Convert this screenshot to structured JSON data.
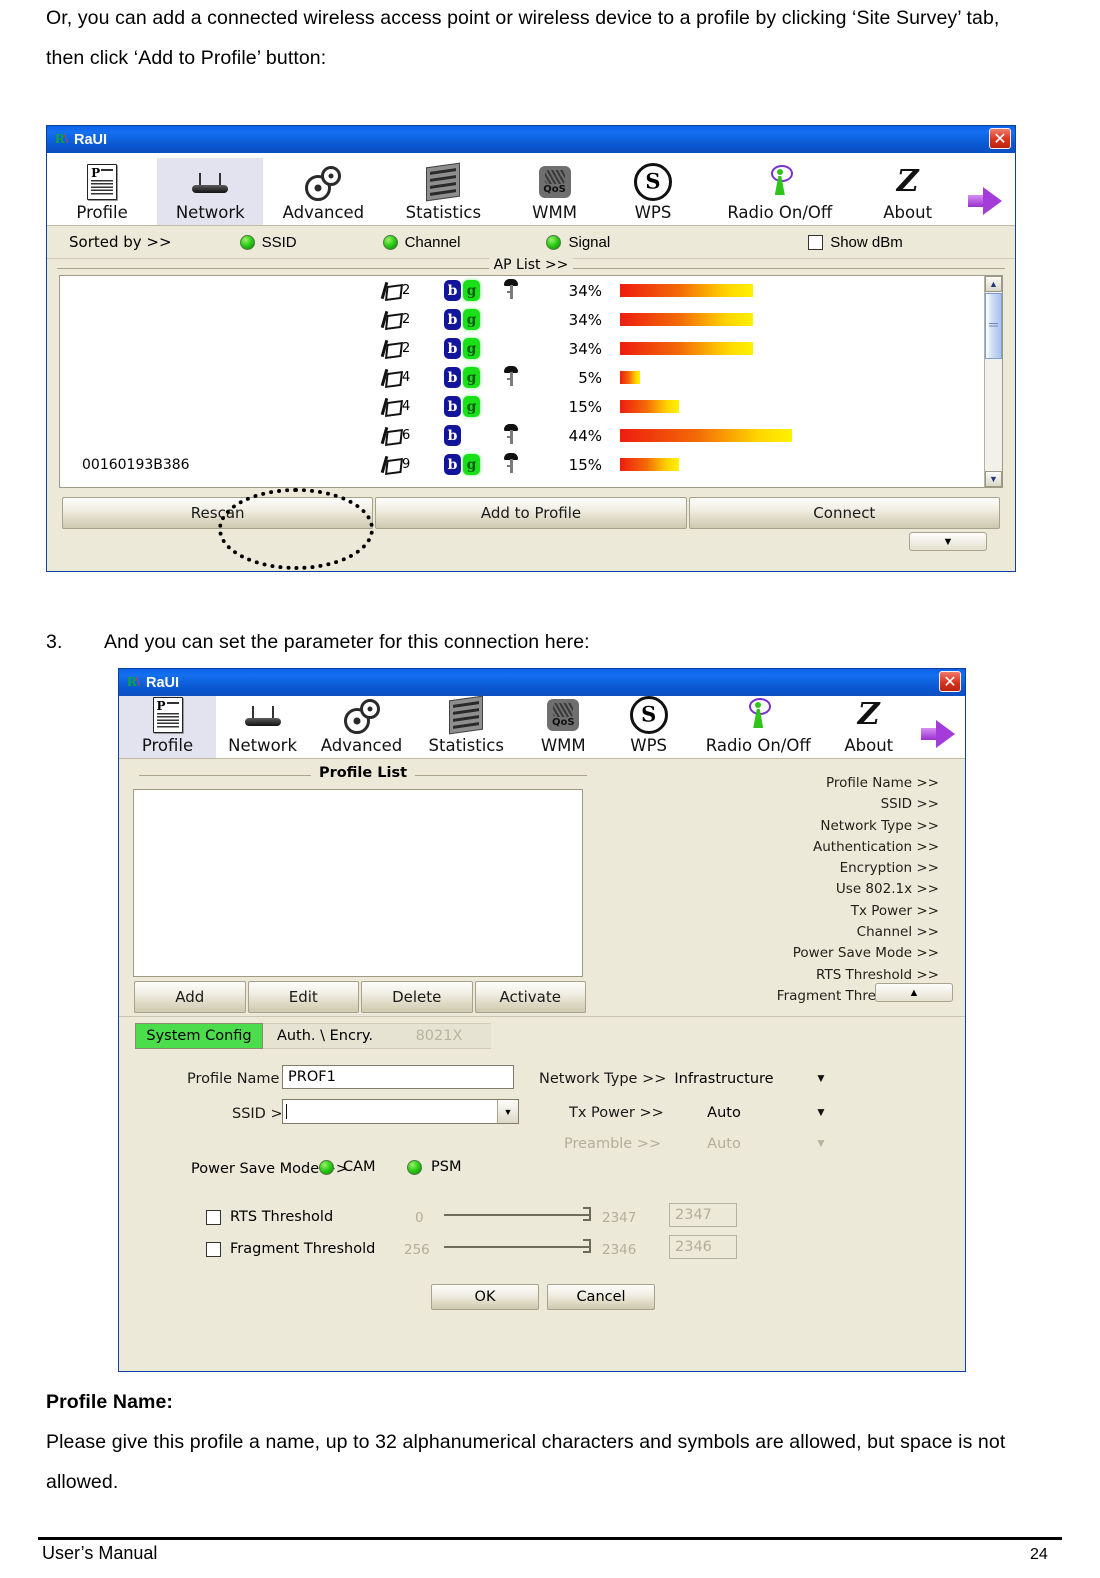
{
  "document": {
    "paragraph_top": "Or, you can add a connected wireless access point or wireless device to a profile by clicking ‘Site Survey’ tab, then click ‘Add to Profile’ button:",
    "step3_number": "3.",
    "step3_text": "And you can set the parameter for this connection here:",
    "profile_name_heading": "Profile Name:",
    "profile_name_body": "Please give this profile a name, up to 32 alphanumerical characters and symbols are allowed, but space is not allowed.",
    "footer_left": "User’s Manual",
    "footer_page": "24"
  },
  "window1": {
    "title": "RaUI",
    "logo_text": "R",
    "close_label": "✕",
    "toolbar": [
      {
        "label": "Profile",
        "icon": "profile-icon",
        "active": false
      },
      {
        "label": "Network",
        "icon": "router-icon",
        "active": true
      },
      {
        "label": "Advanced",
        "icon": "gears-icon",
        "active": false
      },
      {
        "label": "Statistics",
        "icon": "statistics-icon",
        "active": false
      },
      {
        "label": "WMM",
        "icon": "qos-wmm-icon",
        "active": false
      },
      {
        "label": "WPS",
        "icon": "wps-icon",
        "active": false
      },
      {
        "label": "Radio On/Off",
        "icon": "radio-antenna-icon",
        "active": false
      },
      {
        "label": "About",
        "icon": "about-icon",
        "active": false
      },
      {
        "label": "",
        "icon": "purple-arrow-icon",
        "active": false
      }
    ],
    "sortbar": {
      "sorted_by_label": "Sorted by >>",
      "options": [
        "SSID",
        "Channel",
        "Signal"
      ],
      "show_dbm_label": "Show dBm",
      "show_dbm_checked": false
    },
    "ap_list_caption": "AP List >>",
    "ap_rows": [
      {
        "ssid": "",
        "channel": "2",
        "b": "b",
        "g": "g",
        "secured": true,
        "signal_label": "34%",
        "signal": 34
      },
      {
        "ssid": "",
        "channel": "2",
        "b": "b",
        "g": "g",
        "secured": false,
        "signal_label": "34%",
        "signal": 34
      },
      {
        "ssid": "",
        "channel": "2",
        "b": "b",
        "g": "g",
        "secured": false,
        "signal_label": "34%",
        "signal": 34
      },
      {
        "ssid": "",
        "channel": "4",
        "b": "b",
        "g": "g",
        "secured": true,
        "signal_label": "5%",
        "signal": 5
      },
      {
        "ssid": "",
        "channel": "4",
        "b": "b",
        "g": "g",
        "secured": false,
        "signal_label": "15%",
        "signal": 15
      },
      {
        "ssid": "",
        "channel": "6",
        "b": "b",
        "g": "",
        "secured": true,
        "signal_label": "44%",
        "signal": 44
      },
      {
        "ssid": "00160193B386",
        "channel": "9",
        "b": "b",
        "g": "g",
        "secured": true,
        "signal_label": "15%",
        "signal": 15
      }
    ],
    "buttons": [
      "Rescan",
      "Add to Profile",
      "Connect"
    ],
    "pulltab_glyph": "▼"
  },
  "window2": {
    "title": "RaUI",
    "logo_text": "R",
    "close_label": "✕",
    "toolbar": [
      {
        "label": "Profile",
        "icon": "profile-icon",
        "active": true
      },
      {
        "label": "Network",
        "icon": "router-icon",
        "active": false
      },
      {
        "label": "Advanced",
        "icon": "gears-icon",
        "active": false
      },
      {
        "label": "Statistics",
        "icon": "statistics-icon",
        "active": false
      },
      {
        "label": "WMM",
        "icon": "qos-wmm-icon",
        "active": false
      },
      {
        "label": "WPS",
        "icon": "wps-icon",
        "active": false
      },
      {
        "label": "Radio On/Off",
        "icon": "radio-antenna-icon",
        "active": false
      },
      {
        "label": "About",
        "icon": "about-icon",
        "active": false
      },
      {
        "label": "",
        "icon": "purple-arrow-icon",
        "active": false
      }
    ],
    "profile_list_caption": "Profile List",
    "detail_labels": [
      "Profile Name >>",
      "SSID >>",
      "Network Type >>",
      "Authentication >>",
      "Encryption >>",
      "Use 802.1x >>",
      "Tx Power >>",
      "Channel >>",
      "Power Save Mode >>",
      "RTS Threshold >>",
      "Fragment Threshold >>"
    ],
    "list_buttons": [
      "Add",
      "Edit",
      "Delete",
      "Activate"
    ],
    "pulltab_glyph": "▲",
    "tabs": [
      {
        "label": "System Config",
        "state": "selected"
      },
      {
        "label": "Auth. \\ Encry.",
        "state": "normal"
      },
      {
        "label": "8021X",
        "state": "disabled"
      }
    ],
    "form": {
      "profile_name_label": "Profile Name >>",
      "profile_name_value": "PROF1",
      "ssid_label": "SSID >>",
      "ssid_value": "",
      "network_type_label": "Network Type >>",
      "network_type_value": "Infrastructure",
      "tx_power_label": "Tx Power >>",
      "tx_power_value": "Auto",
      "preamble_label": "Preamble >>",
      "preamble_value": "Auto",
      "power_save_label": "Power Save Mode >>",
      "power_save_options": [
        "CAM",
        "PSM"
      ],
      "rts": {
        "label": "RTS Threshold",
        "checked": false,
        "min": "0",
        "max": "2347",
        "value": "2347"
      },
      "fragment": {
        "label": "Fragment Threshold",
        "checked": false,
        "min": "256",
        "max": "2346",
        "value": "2346"
      },
      "ok_label": "OK",
      "cancel_label": "Cancel"
    }
  },
  "colors": {
    "window_face": "#ece9d8",
    "title_blue": "#0b62e8",
    "tab_green": "#4cdd4c",
    "signal_bar_start": "#ee1c10",
    "signal_bar_end": "#fff200"
  }
}
